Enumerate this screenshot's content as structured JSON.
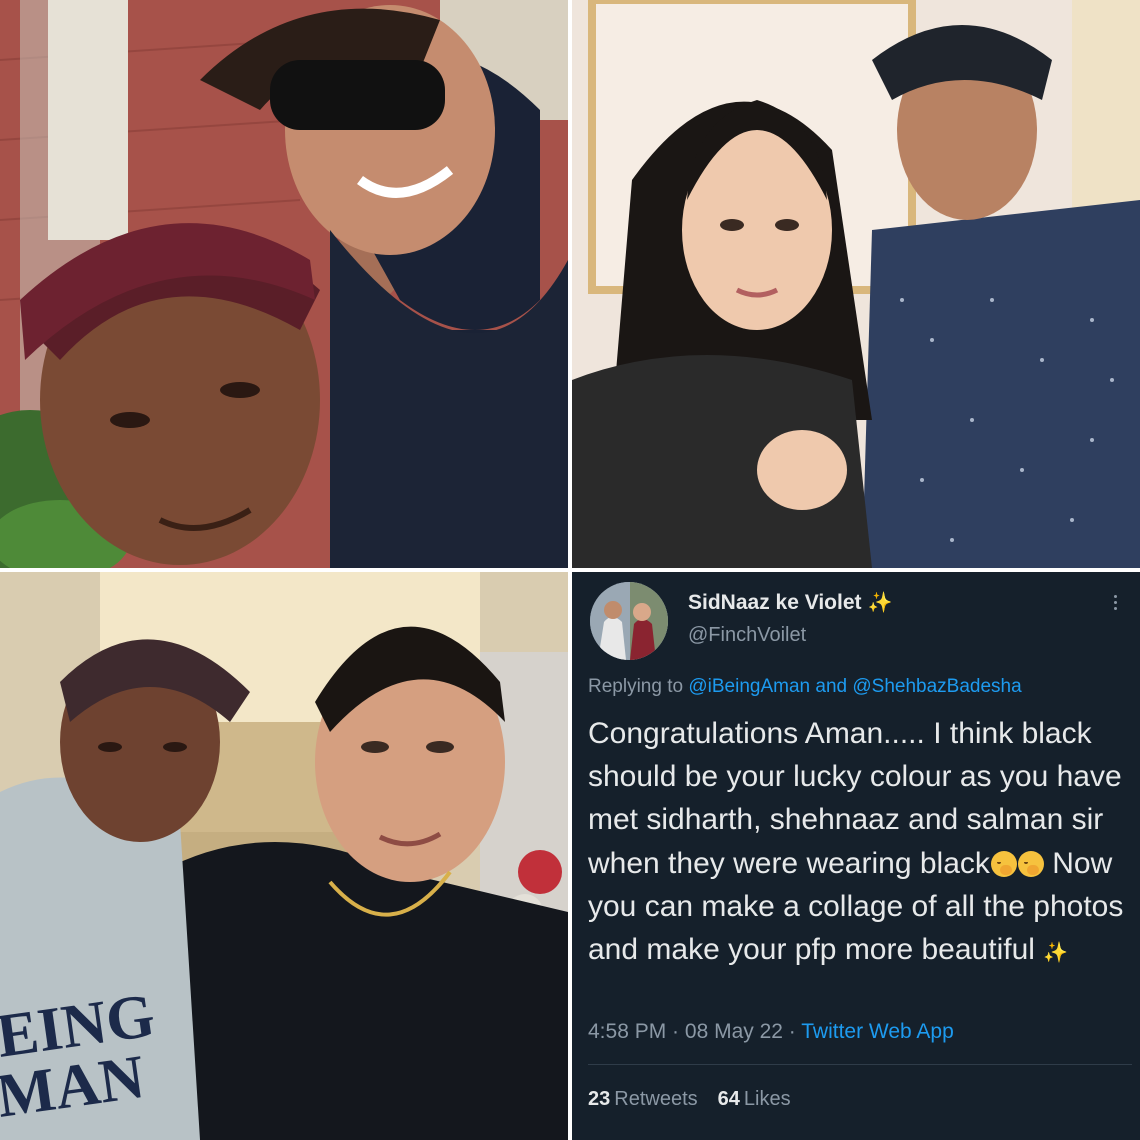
{
  "tweet": {
    "display_name": "SidNaaz ke Violet",
    "name_emoji": "✨",
    "handle": "@FinchVoilet",
    "replying_prefix": "Replying to",
    "mention_1": "@iBeingAman",
    "replying_and": "and",
    "mention_2": "@ShehbazBadesha",
    "body_part1": "Congratulations Aman..... I think black should be your lucky colour as you have met sidharth, shehnaaz and salman sir when they were wearing black",
    "body_part2": " Now you can make a collage of all the photos and make your pfp more beautiful ",
    "body_emoji": "✨",
    "time": "4:58 PM",
    "date": "08 May 22",
    "source": "Twitter Web App",
    "retweets_count": "23",
    "retweets_label": "Retweets",
    "likes_count": "64",
    "likes_label": "Likes"
  },
  "hoodie_text_line1": "EING",
  "hoodie_text_line2": "MAN",
  "colors": {
    "background": "#15202b",
    "link": "#1d9bf0",
    "secondary_text": "#8b98a5",
    "primary_text": "#e7e9ea"
  }
}
